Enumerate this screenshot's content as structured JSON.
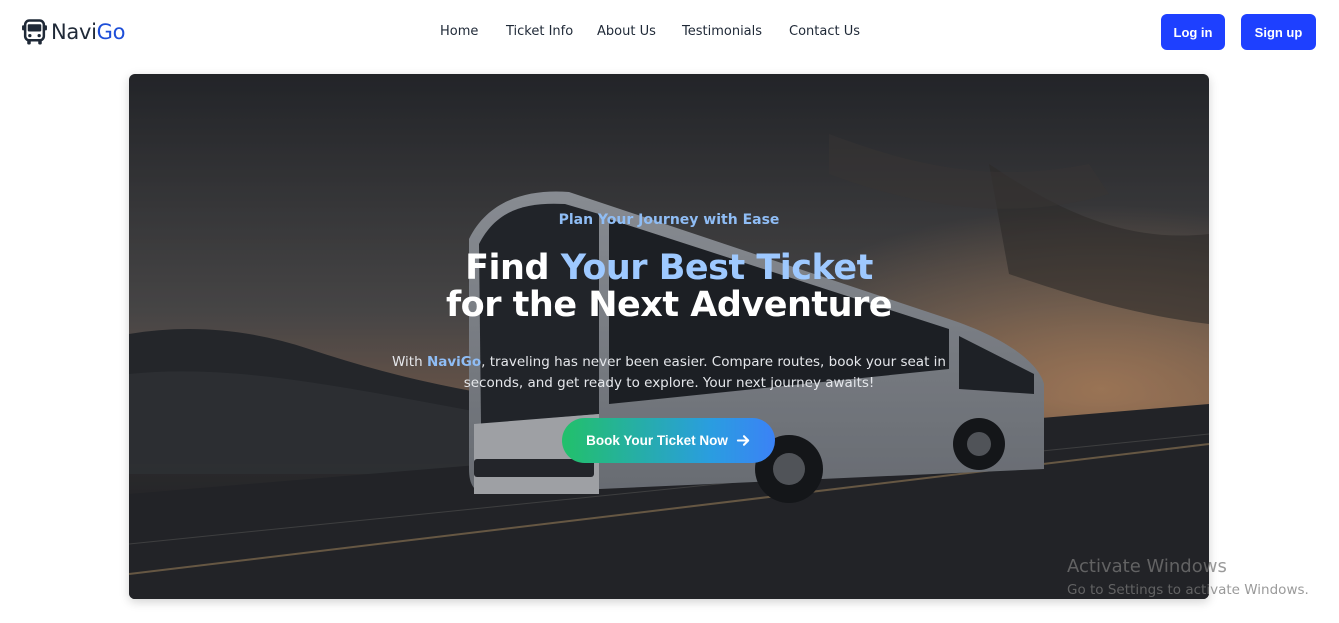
{
  "brand": {
    "name_part1": "Navi",
    "name_part2": "Go",
    "icon": "bus-icon",
    "accent_color": "#1d4ed8"
  },
  "nav": {
    "items": [
      {
        "label": "Home"
      },
      {
        "label": "Ticket Info"
      },
      {
        "label": "About Us"
      },
      {
        "label": "Testimonials"
      },
      {
        "label": "Contact Us"
      }
    ]
  },
  "auth": {
    "login_label": "Log in",
    "signup_label": "Sign up",
    "button_color": "#1e40ff"
  },
  "hero": {
    "tagline": "Plan Your Journey with Ease",
    "headline_part1": "Find ",
    "headline_highlight": "Your Best Ticket",
    "headline_line2": "for the Next Adventure",
    "desc_prefix": "With ",
    "desc_brand": "NaviGo",
    "desc_rest": ", traveling has never been easier. Compare routes, book your seat in seconds, and get ready to explore. Your next journey awaits!",
    "cta_label": "Book Your Ticket Now",
    "cta_icon": "arrow-right-icon",
    "background": "bus-on-highway-sunset-photo"
  },
  "watermark": {
    "title": "Activate Windows",
    "subtitle": "Go to Settings to activate Windows."
  }
}
